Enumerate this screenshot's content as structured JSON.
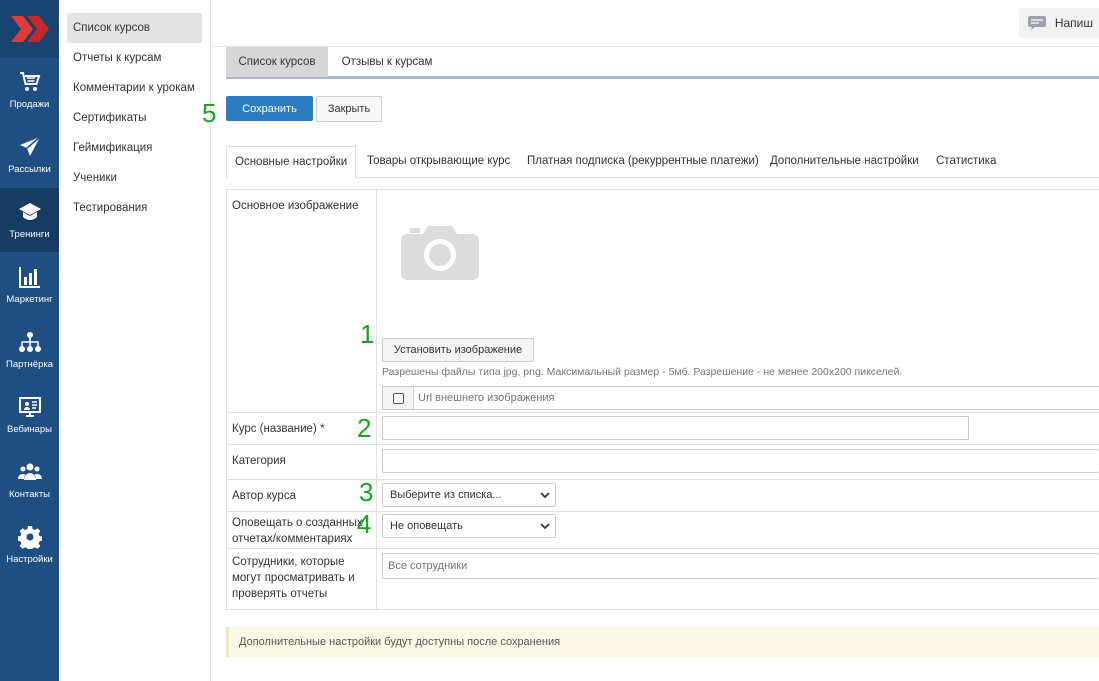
{
  "rail": {
    "items": [
      {
        "label": "Продажи",
        "icon": "cart-icon"
      },
      {
        "label": "Рассылки",
        "icon": "paper-plane-icon"
      },
      {
        "label": "Тренинги",
        "icon": "graduation-cap-icon"
      },
      {
        "label": "Маркетинг",
        "icon": "bar-chart-icon"
      },
      {
        "label": "Партнёрка",
        "icon": "network-icon"
      },
      {
        "label": "Вебинары",
        "icon": "presentation-icon"
      },
      {
        "label": "Контакты",
        "icon": "users-icon"
      },
      {
        "label": "Настройки",
        "icon": "gear-icon"
      }
    ],
    "active": "Тренинги"
  },
  "submenu": {
    "items": [
      "Список курсов",
      "Отчеты к курсам",
      "Комментарии к урокам",
      "Сертификаты",
      "Геймификация",
      "Ученики",
      "Тестирования"
    ],
    "active": "Список курсов"
  },
  "topbar": {
    "write_label": "Напиш"
  },
  "page_tabs": [
    "Список курсов",
    "Отзывы к курсам"
  ],
  "buttons": {
    "save": "Сохранить",
    "close": "Закрыть"
  },
  "form_tabs": [
    "Основные настройки",
    "Товары открывающие курс",
    "Платная подписка (рекуррентные платежи)",
    "Дополнительные настройки",
    "Статистика"
  ],
  "form": {
    "image_label": "Основное изображение",
    "set_image_button": "Установить изображение",
    "image_hint": "Разрешены файлы типа jpg, png. Максимальный размер - 5мб. Разрешение - не менее 200x200 пикселей.",
    "url_placeholder": "Url внешнего изображения",
    "name_label": "Курс (название) *",
    "name_value": "",
    "category_label": "Категория",
    "category_value": "",
    "author_label": "Автор курса",
    "author_value": "Выберите из списка...",
    "notify_label": "Оповещать о созданных отчетах/комментариях",
    "notify_value": "Не оповещать",
    "staff_label": "Сотрудники, которые могут просматривать и проверять отчеты",
    "staff_placeholder": "Все сотрудники"
  },
  "annotations": [
    "1",
    "2",
    "3",
    "4",
    "5"
  ],
  "notice": "Дополнительные настройки будут доступны после сохранения",
  "colors": {
    "rail": "#1f4e82",
    "primary_button": "#2c7cc1",
    "annotation": "#19a41f",
    "notice_bg": "#fcf8e8"
  }
}
